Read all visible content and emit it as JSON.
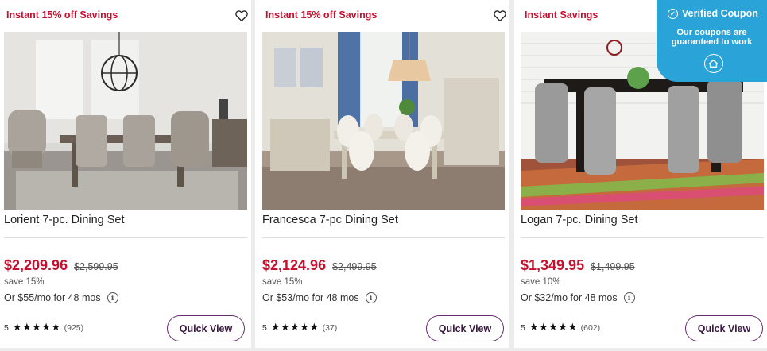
{
  "products": [
    {
      "promo": "Instant 15% off Savings",
      "name": "Lorient 7-pc. Dining Set",
      "sale_price": "$2,209.96",
      "was_price": "$2,599.95",
      "save": "save 15%",
      "financing": "Or $55/mo for 48 mos",
      "rating": "5",
      "stars": "★★★★★",
      "reviews": "(925)",
      "quick_view": "Quick View"
    },
    {
      "promo": "Instant 15% off Savings",
      "name": "Francesca 7-pc Dining Set",
      "sale_price": "$2,124.96",
      "was_price": "$2,499.95",
      "save": "save 15%",
      "financing": "Or $53/mo for 48 mos",
      "rating": "5",
      "stars": "★★★★★",
      "reviews": "(37)",
      "quick_view": "Quick View"
    },
    {
      "promo": "Instant Savings",
      "name": "Logan 7-pc. Dining Set",
      "sale_price": "$1,349.95",
      "was_price": "$1,499.95",
      "save": "save 10%",
      "financing": "Or $32/mo for 48 mos",
      "rating": "5",
      "stars": "★★★★★",
      "reviews": "(602)",
      "quick_view": "Quick View"
    }
  ],
  "info_icon_glyph": "i",
  "coupon_badge": {
    "title": "Verified Coupon",
    "line1": "Our coupons are",
    "line2": "guaranteed to work",
    "check_glyph": "✓"
  },
  "colors": {
    "promo_red": "#c8102e",
    "button_border": "#6a2c72",
    "coupon_blue": "#2aa3d8"
  },
  "icons": [
    "heart-outline-icon",
    "info-icon",
    "star-icon",
    "check-circle-icon",
    "house-logo-icon"
  ]
}
